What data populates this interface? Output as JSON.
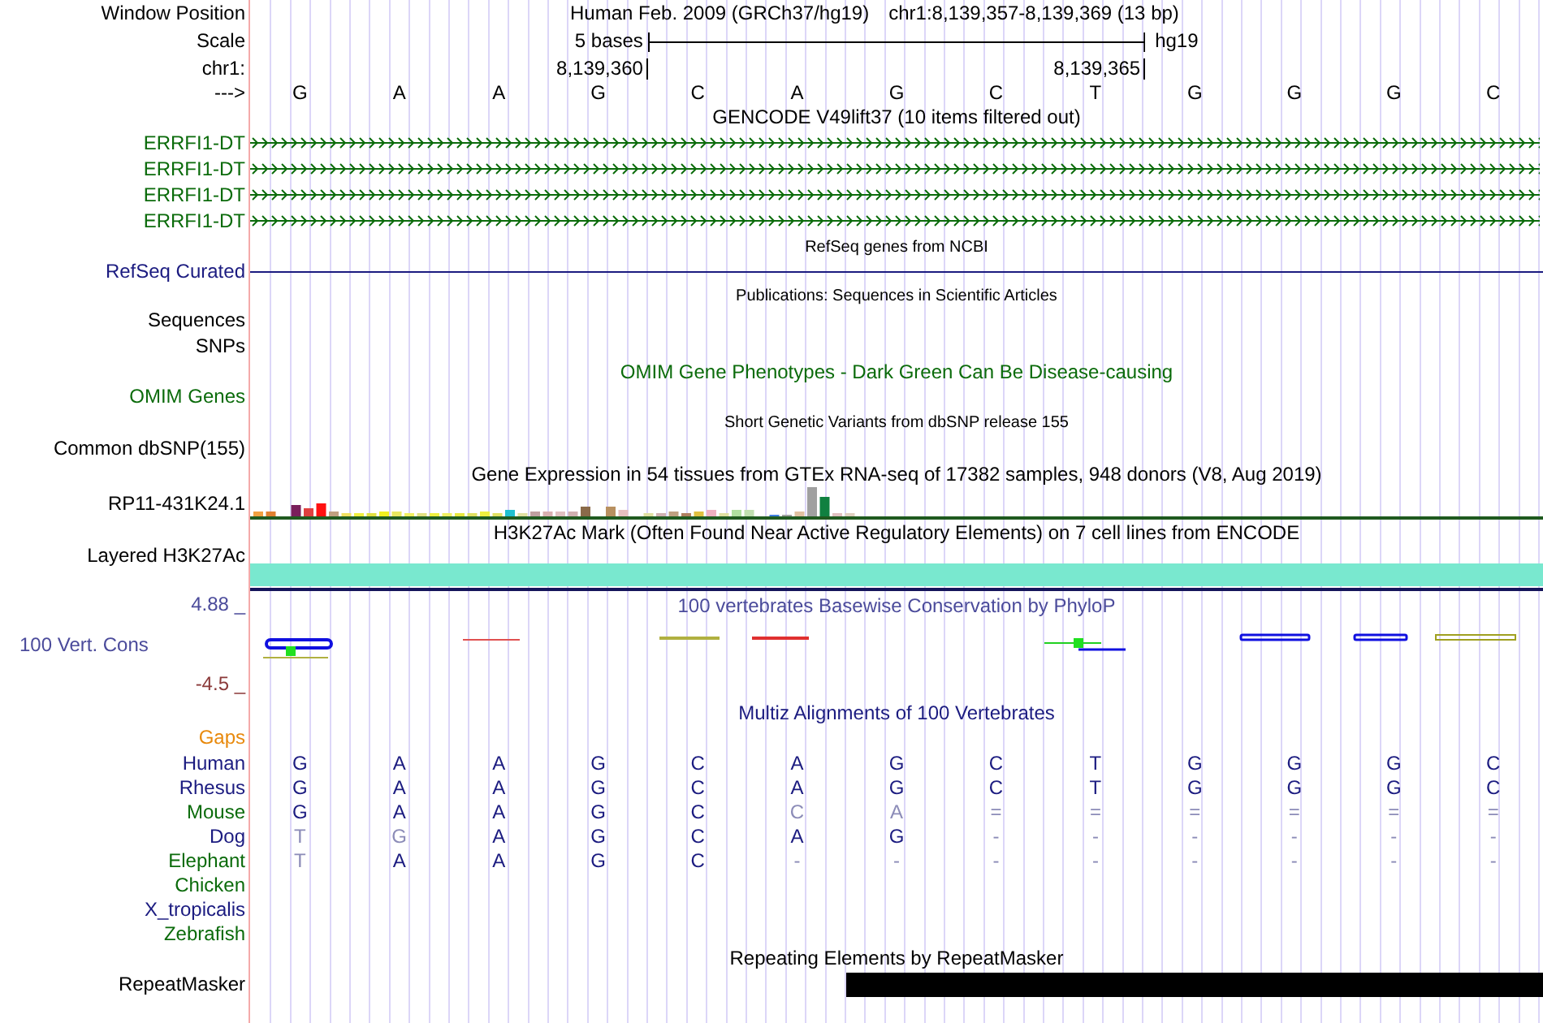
{
  "header": {
    "position_label": "Window Position",
    "assembly_name": "Human Feb. 2009 (GRCh37/hg19)",
    "position": "chr1:8,139,357-8,139,369 (13 bp)",
    "scale_label": "Scale",
    "scale_text": "5 bases",
    "scale_db": "hg19",
    "chrom_label": "chr1:",
    "tick_start": "8,139,360",
    "tick_end": "8,139,365",
    "strand_label": "--->",
    "bases": [
      "G",
      "A",
      "A",
      "G",
      "C",
      "A",
      "G",
      "C",
      "T",
      "G",
      "G",
      "G",
      "C"
    ]
  },
  "tracks": [
    {
      "kind": "title",
      "text": "GENCODE V49lift37 (10 items filtered out)",
      "color": "#000000"
    },
    {
      "kind": "gene",
      "label": "ERRFI1-DT",
      "color": "#0b6b0b"
    },
    {
      "kind": "gene",
      "label": "ERRFI1-DT",
      "color": "#0b6b0b"
    },
    {
      "kind": "gene",
      "label": "ERRFI1-DT",
      "color": "#0b6b0b"
    },
    {
      "kind": "gene",
      "label": "ERRFI1-DT",
      "color": "#0b6b0b"
    },
    {
      "kind": "small-title",
      "text": "RefSeq genes from NCBI"
    },
    {
      "kind": "line",
      "label": "RefSeq Curated",
      "color": "#1b1b80"
    },
    {
      "kind": "small-title",
      "text": "Publications: Sequences in Scientific Articles"
    },
    {
      "kind": "label",
      "label": "Sequences",
      "color": "#000000"
    },
    {
      "kind": "label",
      "label": "SNPs",
      "color": "#000000"
    },
    {
      "kind": "title",
      "text": "OMIM Gene Phenotypes - Dark Green Can Be Disease-causing",
      "color": "#0b6b0b"
    },
    {
      "kind": "label",
      "label": "OMIM Genes",
      "color": "#0b6b0b"
    },
    {
      "kind": "small-title",
      "text": "Short Genetic Variants from dbSNP release 155"
    },
    {
      "kind": "label",
      "label": "Common dbSNP(155)",
      "color": "#000000"
    },
    {
      "kind": "title",
      "text": "Gene Expression in 54 tissues from GTEx RNA-seq of 17382 samples, 948 donors (V8, Aug 2019)",
      "color": "#000000"
    },
    {
      "kind": "expression",
      "label": "RP11-431K24.1",
      "color": "#000000"
    },
    {
      "kind": "title",
      "text": "H3K27Ac Mark (Often Found Near Active Regulatory Elements) on 7 cell lines from ENCODE",
      "color": "#000000"
    },
    {
      "kind": "band",
      "label": "Layered H3K27Ac",
      "color": "#000000"
    },
    {
      "kind": "conservation",
      "max": "4.88 _",
      "min": "-4.5 _",
      "title": "100 vertebrates Basewise Conservation by PhyloP",
      "label": "100 Vert. Cons",
      "color": "#4b4b9b"
    },
    {
      "kind": "title",
      "text": "Multiz Alignments of 100 Vertebrates",
      "color": "#1b1b80"
    },
    {
      "kind": "label",
      "label": "Gaps",
      "color": "#e8890c"
    },
    {
      "kind": "species",
      "label": "Human",
      "color": "#1b1b80",
      "bases": [
        {
          "base": "G",
          "faded": false
        },
        {
          "base": "A",
          "faded": false
        },
        {
          "base": "A",
          "faded": false
        },
        {
          "base": "G",
          "faded": false
        },
        {
          "base": "C",
          "faded": false
        },
        {
          "base": "A",
          "faded": false
        },
        {
          "base": "G",
          "faded": false
        },
        {
          "base": "C",
          "faded": false
        },
        {
          "base": "T",
          "faded": false
        },
        {
          "base": "G",
          "faded": false
        },
        {
          "base": "G",
          "faded": false
        },
        {
          "base": "G",
          "faded": false
        },
        {
          "base": "C",
          "faded": false
        }
      ]
    },
    {
      "kind": "species",
      "label": "Rhesus",
      "color": "#1b1b80",
      "bases": [
        {
          "base": "G",
          "faded": false
        },
        {
          "base": "A",
          "faded": false
        },
        {
          "base": "A",
          "faded": false
        },
        {
          "base": "G",
          "faded": false
        },
        {
          "base": "C",
          "faded": false
        },
        {
          "base": "A",
          "faded": false
        },
        {
          "base": "G",
          "faded": false
        },
        {
          "base": "C",
          "faded": false
        },
        {
          "base": "T",
          "faded": false
        },
        {
          "base": "G",
          "faded": false
        },
        {
          "base": "G",
          "faded": false
        },
        {
          "base": "G",
          "faded": false
        },
        {
          "base": "C",
          "faded": false
        }
      ]
    },
    {
      "kind": "species",
      "label": "Mouse",
      "color": "#0b6b0b",
      "bases": [
        {
          "base": "G",
          "faded": false
        },
        {
          "base": "A",
          "faded": false
        },
        {
          "base": "A",
          "faded": false
        },
        {
          "base": "G",
          "faded": false
        },
        {
          "base": "C",
          "faded": false
        },
        {
          "base": "C",
          "faded": true
        },
        {
          "base": "A",
          "faded": true
        },
        {
          "base": "=",
          "faded": true
        },
        {
          "base": "=",
          "faded": true
        },
        {
          "base": "=",
          "faded": true
        },
        {
          "base": "=",
          "faded": true
        },
        {
          "base": "=",
          "faded": true
        },
        {
          "base": "=",
          "faded": true
        }
      ]
    },
    {
      "kind": "species",
      "label": "Dog",
      "color": "#1b1b80",
      "bases": [
        {
          "base": "T",
          "faded": true
        },
        {
          "base": "G",
          "faded": true
        },
        {
          "base": "A",
          "faded": false
        },
        {
          "base": "G",
          "faded": false
        },
        {
          "base": "C",
          "faded": false
        },
        {
          "base": "A",
          "faded": false
        },
        {
          "base": "G",
          "faded": false
        },
        {
          "base": "-",
          "faded": true
        },
        {
          "base": "-",
          "faded": true
        },
        {
          "base": "-",
          "faded": true
        },
        {
          "base": "-",
          "faded": true
        },
        {
          "base": "-",
          "faded": true
        },
        {
          "base": "-",
          "faded": true
        }
      ]
    },
    {
      "kind": "species",
      "label": "Elephant",
      "color": "#0b6b0b",
      "bases": [
        {
          "base": "T",
          "faded": true
        },
        {
          "base": "A",
          "faded": false
        },
        {
          "base": "A",
          "faded": false
        },
        {
          "base": "G",
          "faded": false
        },
        {
          "base": "C",
          "faded": false
        },
        {
          "base": "-",
          "faded": true
        },
        {
          "base": "-",
          "faded": true
        },
        {
          "base": "-",
          "faded": true
        },
        {
          "base": "-",
          "faded": true
        },
        {
          "base": "-",
          "faded": true
        },
        {
          "base": "-",
          "faded": true
        },
        {
          "base": "-",
          "faded": true
        },
        {
          "base": "-",
          "faded": true
        }
      ]
    },
    {
      "kind": "species",
      "label": "Chicken",
      "color": "#0b6b0b"
    },
    {
      "kind": "species",
      "label": "X_tropicalis",
      "color": "#1b1b80"
    },
    {
      "kind": "species",
      "label": "Zebrafish",
      "color": "#0b6b0b"
    },
    {
      "kind": "title",
      "text": "Repeating Elements by RepeatMasker",
      "color": "#000000"
    },
    {
      "kind": "repeat",
      "label": "RepeatMasker",
      "color": "#000000"
    }
  ]
}
